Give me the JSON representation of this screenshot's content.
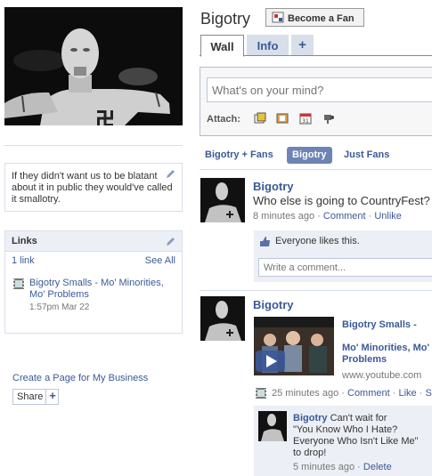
{
  "page": {
    "name": "Bigotry",
    "fan_button": "Become a Fan"
  },
  "tabs": [
    {
      "label": "Wall"
    },
    {
      "label": "Info"
    },
    {
      "label": "+"
    }
  ],
  "publisher": {
    "placeholder": "What's on your mind?",
    "attach_label": "Attach:",
    "attach_icons": [
      "photo-icon",
      "video-icon",
      "event-icon",
      "link-icon"
    ]
  },
  "filters": [
    "Bigotry + Fans",
    "Bigotry",
    "Just Fans"
  ],
  "sidebar": {
    "bio": "If they didn't want us to be blatant about it in public they would've called it smallotry.",
    "links": {
      "title": "Links",
      "count": "1 link",
      "see_all": "See All",
      "item_title": "Bigotry Smalls - Mo' Minorities, Mo' Problems",
      "item_time": "1:57pm Mar 22"
    },
    "create_page": "Create a Page for My Business",
    "share": "Share"
  },
  "feed": [
    {
      "actor": "Bigotry",
      "message": "Who else is going to CountryFest?",
      "time": "8 minutes ago",
      "actions": [
        "Comment",
        "Unlike"
      ],
      "likes_text": "Everyone likes this.",
      "comment_placeholder": "Write a comment..."
    },
    {
      "actor": "Bigotry",
      "link_title_1": "Bigotry Smalls -",
      "link_title_2": "Mo' Minorities, Mo' Problems",
      "link_domain": "www.youtube.com",
      "time": "25 minutes ago",
      "actions": [
        "Comment",
        "Like",
        "Sh"
      ],
      "comment": {
        "author": "Bigotry",
        "text_1": "Can't wait for",
        "text_2": "\"You Know Who I Hate?",
        "text_3": "Everyone Who Isn't Like Me\"",
        "text_4": "to drop!",
        "time": "5 minutes ago",
        "delete": "Delete"
      }
    }
  ],
  "colors": {
    "link": "#3b5998",
    "tab_bg": "#d8dfea",
    "filter_selected": "#6d84b4",
    "comment_bg": "#eceff5"
  }
}
